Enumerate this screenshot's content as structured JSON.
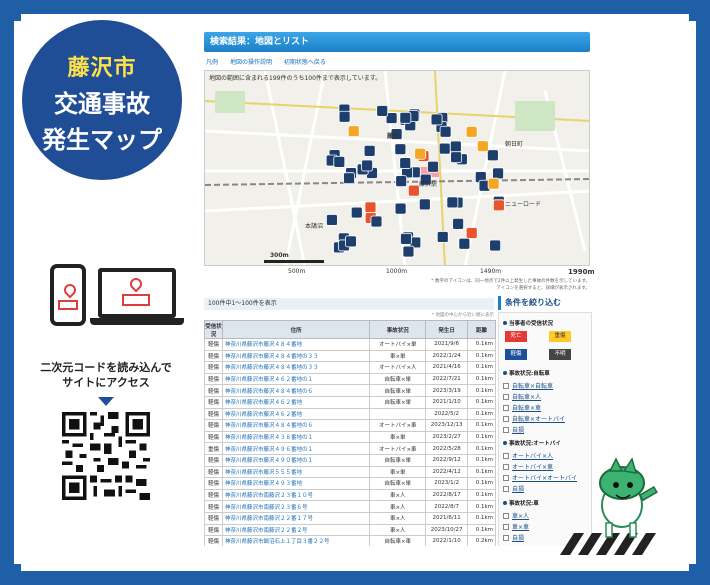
{
  "badge": {
    "line1": "藤沢市",
    "line2": "交通事故",
    "line3": "発生マップ"
  },
  "cta": {
    "line1": "二次元コードを読み込んで",
    "line2": "サイトにアクセス"
  },
  "panel": {
    "title": "検索結果：地図とリスト",
    "links": [
      "凡例",
      "地図の操作説明",
      "初期状態へ戻る"
    ],
    "map_note": "地図の範囲に含まれる199件のうち100件まで表示しています。",
    "map_labels": [
      "藤沢市",
      "辻堂駅",
      "藤沢駅",
      "朝日町",
      "日大前",
      "鵠沼",
      "藤沢",
      "善行",
      "本鵠沼",
      "鵠沼海岸",
      "亀の甲",
      "ニューロード"
    ],
    "scale": {
      "bar": "300m",
      "ticks": [
        "500m",
        "1000m",
        "1490m",
        "1990m"
      ]
    },
    "notes": [
      "* 数字のアイコンは、同一地点で2件以上発生した事故の件数を示しています。",
      "アイコンを選択すると、詳細が表示されます。"
    ],
    "count_text": "100件中1～100件を表示",
    "sub_note": "* 地図の中心から近い順に表示",
    "table": {
      "headers": [
        "受信状況",
        "住所",
        "事故状況",
        "発生日",
        "距離"
      ],
      "rows": [
        [
          "軽傷",
          "神奈川県藤沢市藤沢４８４番地",
          "オートバイ×単",
          "2021/9/6",
          "0.1km"
        ],
        [
          "軽傷",
          "神奈川県藤沢市藤沢４８４番地の３３",
          "車×単",
          "2022/1/24",
          "0.1km"
        ],
        [
          "軽傷",
          "神奈川県藤沢市藤沢４８４番地の３３",
          "オートバイ×人",
          "2021/4/16",
          "0.1km"
        ],
        [
          "軽傷",
          "神奈川県藤沢市藤沢４６２番地の１",
          "自転車×単",
          "2022/7/21",
          "0.1km"
        ],
        [
          "軽傷",
          "神奈川県藤沢市藤沢４８４番地の６",
          "自転車×単",
          "2023/3/19",
          "0.1km"
        ],
        [
          "軽傷",
          "神奈川県藤沢市藤沢４６２番地",
          "自転車×単",
          "2021/1/10",
          "0.1km"
        ],
        [
          "軽傷",
          "神奈川県藤沢市藤沢４６２番地",
          "",
          "2022/5/2",
          "0.1km"
        ],
        [
          "軽傷",
          "神奈川県藤沢市藤沢４８４番地の６",
          "オートバイ×車",
          "2023/12/13",
          "0.1km"
        ],
        [
          "軽傷",
          "神奈川県藤沢市藤沢４３８番地の１",
          "車×単",
          "2023/2/27",
          "0.1km"
        ],
        [
          "重傷",
          "神奈川県藤沢市藤沢４９６番地の１",
          "オートバイ×車",
          "2022/5/28",
          "0.1km"
        ],
        [
          "軽傷",
          "神奈川県藤沢市藤沢４９０番地の１",
          "自転車×単",
          "2022/9/12",
          "0.1km"
        ],
        [
          "軽傷",
          "神奈川県藤沢市藤沢５５５番地",
          "車×単",
          "2022/4/12",
          "0.1km"
        ],
        [
          "軽傷",
          "神奈川県藤沢市藤沢４９３番地",
          "自転車×単",
          "2023/1/2",
          "0.1km"
        ],
        [
          "軽傷",
          "神奈川県藤沢市南藤沢２３番１０号",
          "車×人",
          "2022/8/17",
          "0.1km"
        ],
        [
          "軽傷",
          "神奈川県藤沢市南藤沢２３番６号",
          "車×人",
          "2022/8/7",
          "0.1km"
        ],
        [
          "軽傷",
          "神奈川県藤沢市南藤沢２２番１７号",
          "車×人",
          "2021/6/11",
          "0.1km"
        ],
        [
          "軽傷",
          "神奈川県藤沢市南藤沢２２番２号",
          "車×人",
          "2023/10/27",
          "0.1km"
        ],
        [
          "軽傷",
          "神奈川県藤沢市鵠沼石上１丁目３番２２号",
          "自転車×車",
          "2022/1/10",
          "0.2km"
        ],
        [
          "軽傷",
          "神奈川県藤沢市藤沢４８４番地の１",
          "車×単",
          "2022/5/26",
          "0.2km"
        ],
        [
          "重傷",
          "神奈川県藤沢市藤沢５４５番地",
          "車×人",
          "2021/5/19",
          "0.2km"
        ]
      ]
    },
    "filter": {
      "title": "条件を絞り込む",
      "section1": "当事者の受信状況",
      "severity": [
        "死亡",
        "重傷",
        "軽傷",
        "不明"
      ],
      "section2": "事故状況:自転車",
      "bike": [
        "自転車×自転車",
        "自転車×人",
        "自転車×車",
        "自転車×オートバイ",
        "自損"
      ],
      "section3": "事故状況:オートバイ",
      "moto": [
        "オートバイ×人",
        "オートバイ×車",
        "オートバイ×オートバイ",
        "自損"
      ],
      "section4": "事故状況:車",
      "car": [
        "車×人",
        "車×車",
        "自損"
      ]
    }
  },
  "colors": {
    "frame": "#1f5fa8",
    "badge": "#1f4e96",
    "accent": "#ffe14a",
    "title": "#1c7fc8"
  }
}
